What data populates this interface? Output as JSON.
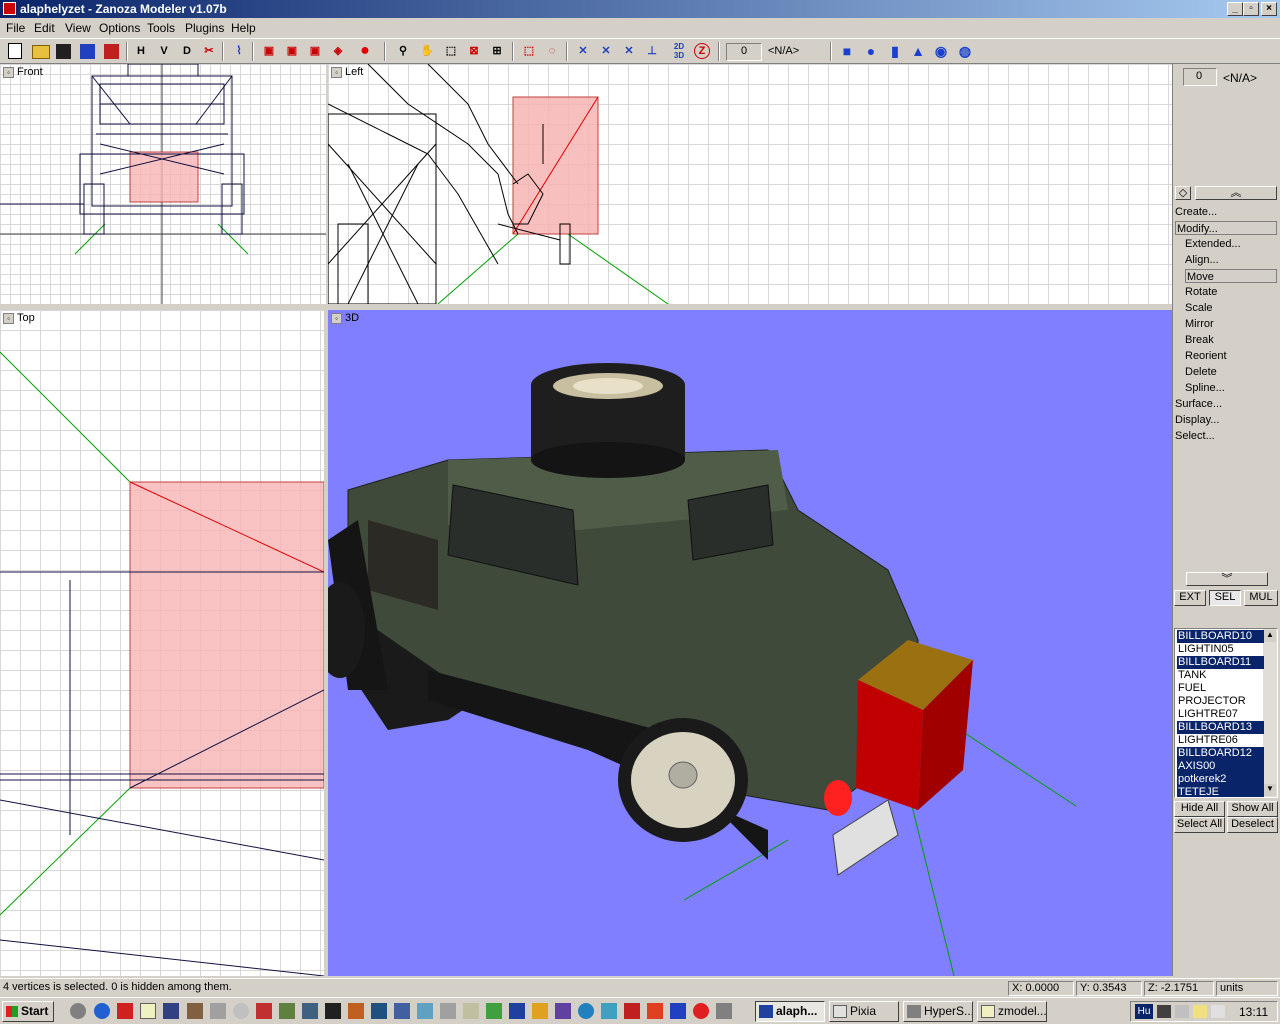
{
  "window": {
    "title": "alaphelyzet - Zanoza Modeler v1.07b"
  },
  "menu": [
    "File",
    "Edit",
    "View",
    "Options",
    "Tools",
    "Plugins",
    "Help"
  ],
  "toolbar": {
    "letter_buttons": [
      "H",
      "V",
      "D"
    ],
    "spin_value": "0",
    "na_value": "<N/A>"
  },
  "viewports": {
    "front": "Front",
    "left": "Left",
    "top": "Top",
    "persp": "3D"
  },
  "panel": {
    "spin_value": "0",
    "na_value": "<N/A>",
    "menu": [
      {
        "label": "Create...",
        "sub": false,
        "selected": false
      },
      {
        "label": "Modify...",
        "sub": false,
        "selected": true
      },
      {
        "label": "Extended...",
        "sub": true,
        "selected": false
      },
      {
        "label": "Align...",
        "sub": true,
        "selected": false
      },
      {
        "label": "Move",
        "sub": true,
        "selected": true
      },
      {
        "label": "Rotate",
        "sub": true,
        "selected": false
      },
      {
        "label": "Scale",
        "sub": true,
        "selected": false
      },
      {
        "label": "Mirror",
        "sub": true,
        "selected": false
      },
      {
        "label": "Break",
        "sub": true,
        "selected": false
      },
      {
        "label": "Reorient",
        "sub": true,
        "selected": false
      },
      {
        "label": "Delete",
        "sub": true,
        "selected": false
      },
      {
        "label": "Spline...",
        "sub": true,
        "selected": false
      },
      {
        "label": "Surface...",
        "sub": false,
        "selected": false
      },
      {
        "label": "Display...",
        "sub": false,
        "selected": false
      },
      {
        "label": "Select...",
        "sub": false,
        "selected": false
      }
    ],
    "modes": [
      "EXT",
      "SEL",
      "MUL"
    ],
    "active_mode": "SEL",
    "objects": [
      {
        "name": "BILLBOARD10",
        "selected": true
      },
      {
        "name": "LIGHTIN05",
        "selected": false
      },
      {
        "name": "BILLBOARD11",
        "selected": true
      },
      {
        "name": "TANK",
        "selected": false
      },
      {
        "name": "FUEL",
        "selected": false
      },
      {
        "name": "PROJECTOR",
        "selected": false
      },
      {
        "name": "LIGHTRE07",
        "selected": false
      },
      {
        "name": "BILLBOARD13",
        "selected": true
      },
      {
        "name": "LIGHTRE06",
        "selected": false
      },
      {
        "name": "BILLBOARD12",
        "selected": true
      },
      {
        "name": "AXIS00",
        "selected": true
      },
      {
        "name": "potkerek2",
        "selected": true
      },
      {
        "name": "TETEJE",
        "selected": true
      }
    ],
    "buttons": {
      "hide_all": "Hide All",
      "show_all": "Show All",
      "select_all": "Select All",
      "deselect": "Deselect"
    }
  },
  "status": {
    "message": "4 vertices is selected. 0 is hidden among them.",
    "x": "X: 0.0000",
    "y": "Y: 0.3543",
    "z": "Z: -2.1751",
    "units": "units"
  },
  "taskbar": {
    "start": "Start",
    "tasks": [
      {
        "label": "alaph...",
        "active": true
      },
      {
        "label": "Pixia",
        "active": false
      },
      {
        "label": "HyperS...",
        "active": false
      },
      {
        "label": "zmodel...",
        "active": false
      }
    ],
    "tray_lang": "Hu",
    "clock": "13:11"
  },
  "colors": {
    "titlebar": "#0a246a",
    "selection": "#0a246a",
    "viewport_3d_bg": "#7f7fff",
    "selection_fill": "#f7b4b4"
  }
}
